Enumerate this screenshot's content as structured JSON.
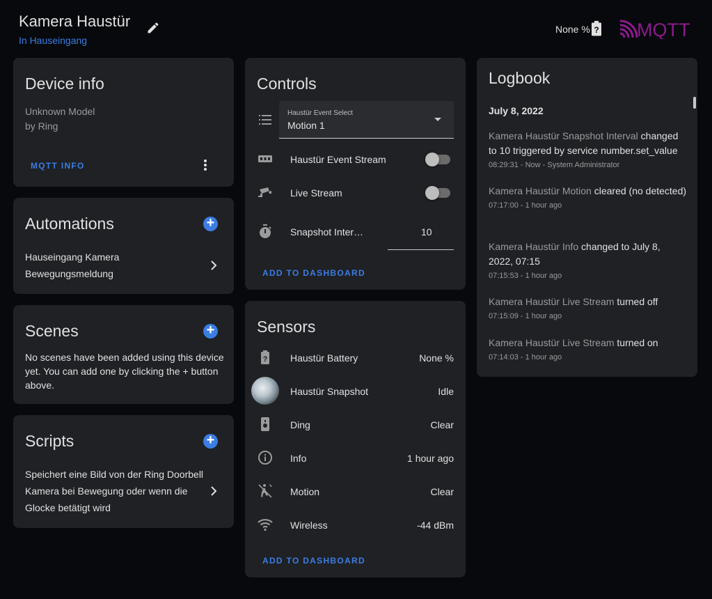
{
  "header": {
    "title": "Kamera Haustür",
    "area": "In Hauseingang",
    "battery_text": "None %",
    "logo_text": "MQTT"
  },
  "device_info": {
    "title": "Device info",
    "model": "Unknown Model",
    "manufacturer": "by Ring",
    "mqtt_button": "MQTT INFO"
  },
  "automations": {
    "title": "Automations",
    "item_line1": "Hauseingang Kamera",
    "item_line2": "Bewegungsmeldung"
  },
  "scenes": {
    "title": "Scenes",
    "empty_line1": "No scenes have been added using this device",
    "empty_line2": "yet. You can add one by clicking the + button",
    "empty_line3": "above."
  },
  "scripts": {
    "title": "Scripts",
    "item_line1": "Speichert eine Bild von der Ring Doorbell",
    "item_line2": "Kamera bei Bewegung oder wenn die",
    "item_line3": "Glocke betätigt wird"
  },
  "controls": {
    "title": "Controls",
    "select_label": "Haustür Event Select",
    "select_value": "Motion 1",
    "event_stream_label": "Haustür Event Stream",
    "live_stream_label": "Live Stream",
    "snapshot_label": "Snapshot Inter…",
    "snapshot_value": "10",
    "add_button": "ADD TO DASHBOARD"
  },
  "sensors": {
    "title": "Sensors",
    "rows": [
      {
        "label": "Haustür Battery",
        "value": "None %",
        "icon": "battery-unknown-icon"
      },
      {
        "label": "Haustür Snapshot",
        "value": "Idle",
        "icon": "snapshot-thumbnail"
      },
      {
        "label": "Ding",
        "value": "Clear",
        "icon": "doorbell-icon"
      },
      {
        "label": "Info",
        "value": "1 hour ago",
        "icon": "info-icon"
      },
      {
        "label": "Motion",
        "value": "Clear",
        "icon": "motion-sensor-icon"
      },
      {
        "label": "Wireless",
        "value": "-44 dBm",
        "icon": "wifi-icon"
      }
    ],
    "add_button": "ADD TO DASHBOARD"
  },
  "logbook": {
    "title": "Logbook",
    "date": "July 8, 2022",
    "entries": [
      {
        "entity": "Kamera Haustür Snapshot Interval",
        "message": " changed to 10 triggered by service number.set_value",
        "time": "08:29:31 - Now - System Administrator"
      },
      {
        "entity": "Kamera Haustür Motion",
        "message": " cleared (no detected)",
        "time": "07:17:00 - 1 hour ago"
      },
      {
        "entity": "Kamera Haustür Info",
        "message": " changed to July 8, 2022, 07:15",
        "time": "07:15:53 - 1 hour ago"
      },
      {
        "entity": "Kamera Haustür Live Stream",
        "message": " turned off",
        "time": "07:15:09 - 1 hour ago"
      },
      {
        "entity": "Kamera Haustür Live Stream",
        "message": " turned on",
        "time": "07:14:03 - 1 hour ago"
      }
    ]
  }
}
